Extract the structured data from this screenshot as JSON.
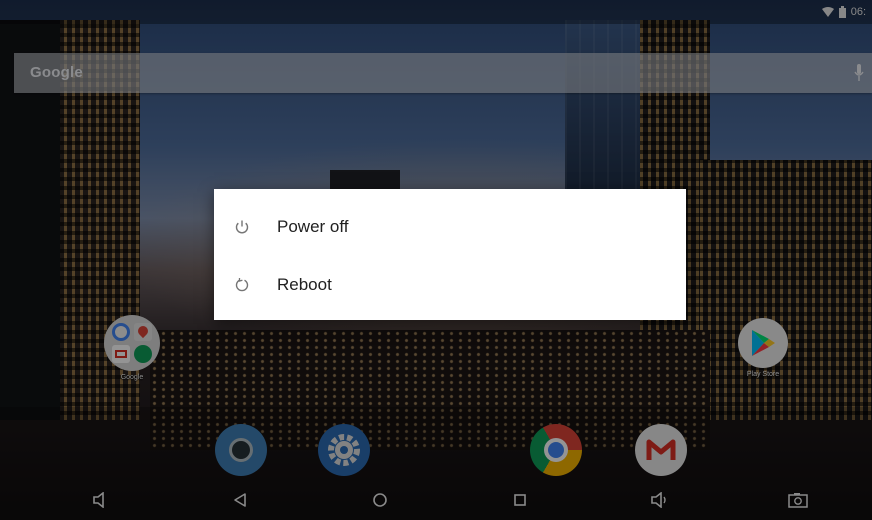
{
  "status_bar": {
    "time": "06:"
  },
  "search_bar": {
    "logo_text": "Google",
    "mic_icon": "mic-icon"
  },
  "desktop_icons": [
    {
      "name": "google-folder",
      "label": "Google"
    },
    {
      "name": "play-store",
      "label": "Play Store"
    }
  ],
  "dock": {
    "apps": [
      {
        "name": "camera-app",
        "icon": "camera-lens-icon"
      },
      {
        "name": "settings-app",
        "icon": "gear-icon"
      },
      {
        "name": "chrome-app",
        "icon": "chrome-icon"
      },
      {
        "name": "gmail-app",
        "icon": "gmail-icon"
      }
    ]
  },
  "nav_bar": {
    "buttons": [
      {
        "name": "volume-down",
        "icon": "speaker-icon"
      },
      {
        "name": "back",
        "icon": "back-triangle-icon"
      },
      {
        "name": "home",
        "icon": "home-circle-icon"
      },
      {
        "name": "recents",
        "icon": "square-icon"
      },
      {
        "name": "volume-up",
        "icon": "speaker-icon"
      },
      {
        "name": "screenshot",
        "icon": "camera-icon"
      }
    ]
  },
  "power_menu": {
    "items": [
      {
        "label": "Power off",
        "icon": "power-icon"
      },
      {
        "label": "Reboot",
        "icon": "restart-icon"
      }
    ]
  },
  "colors": {
    "dialog_bg": "#ffffff",
    "dialog_text": "#212121",
    "icon_gray": "#757575",
    "chrome_red": "#db4437",
    "chrome_yellow": "#f4b400",
    "chrome_green": "#0f9d58",
    "chrome_blue": "#4285f4",
    "gmail_red": "#d93025"
  }
}
